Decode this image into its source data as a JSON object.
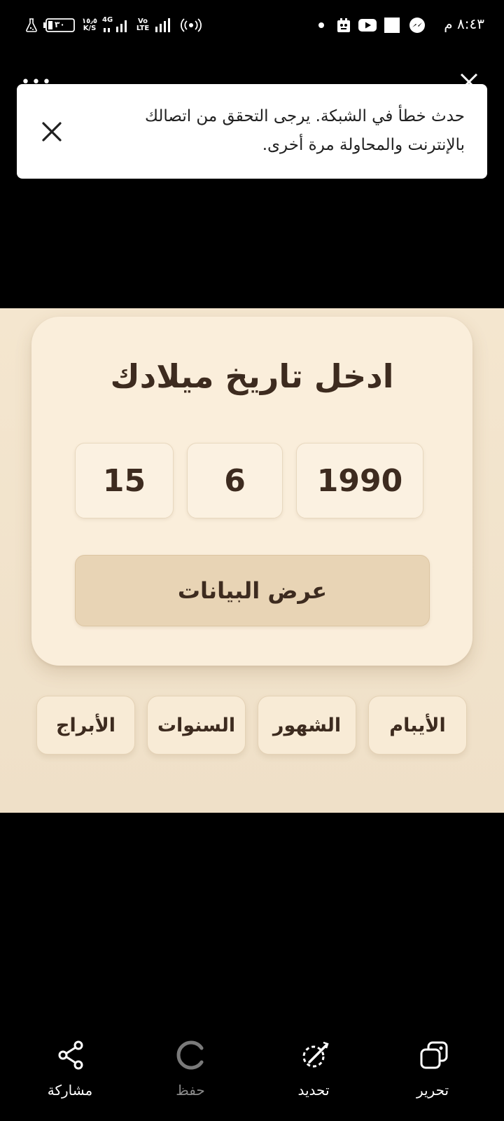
{
  "status_bar": {
    "time": "٨:٤٣ م",
    "battery": "٣٠",
    "speed_value": "١٥٫٥",
    "speed_unit": "K/S",
    "network_4g": "4G",
    "volte_top": "Vo",
    "volte_bottom": "LTE"
  },
  "toast": {
    "message": "حدث خطأ في الشبكة. يرجى التحقق من اتصالك بالإنترنت والمحاولة مرة أخرى."
  },
  "app": {
    "title": "ادخل تاريخ ميلادك",
    "year": "1990",
    "month": "6",
    "day": "15",
    "show_button": "عرض البيانات",
    "tabs": {
      "days": "الأيبام",
      "months": "الشهور",
      "years": "السنوات",
      "zodiac": "الأبراج"
    }
  },
  "bottom_bar": {
    "edit": "تحرير",
    "select": "تحديد",
    "save": "حفظ",
    "share": "مشاركة"
  },
  "colors": {
    "app_background": "#f4e6cf",
    "card": "#faeedb",
    "button": "#e8d4b5",
    "text_dark": "#3d2b1f"
  }
}
